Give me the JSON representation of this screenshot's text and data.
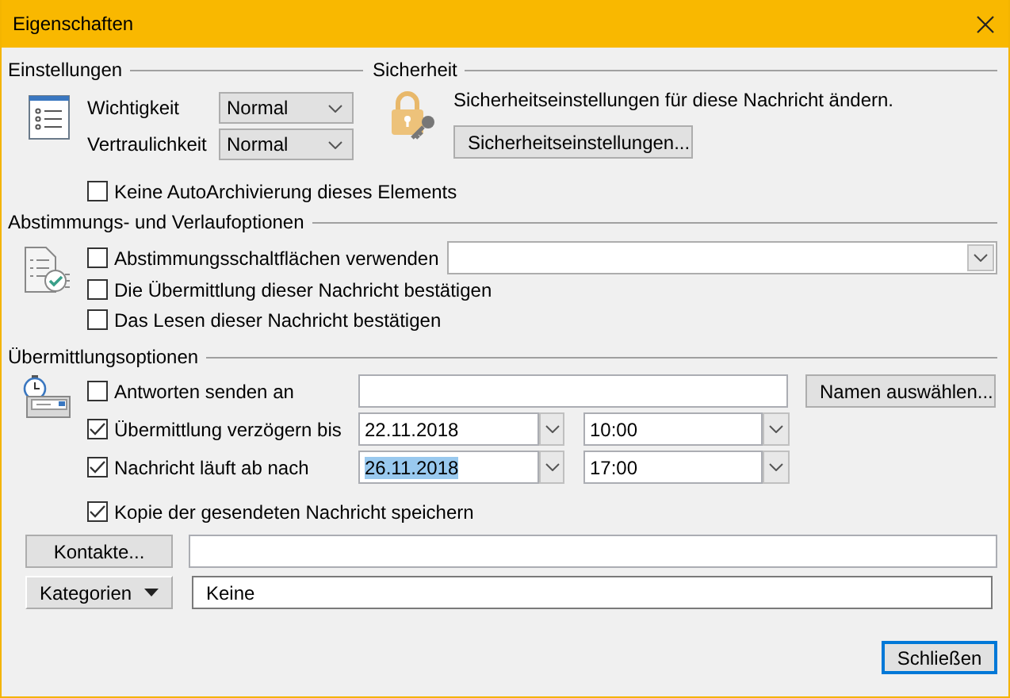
{
  "window": {
    "title": "Eigenschaften"
  },
  "settings": {
    "heading": "Einstellungen",
    "fields": [
      {
        "label": "Wichtigkeit",
        "value": "Normal"
      },
      {
        "label": "Vertraulichkeit",
        "value": "Normal"
      }
    ],
    "options": [
      {
        "label": "Keine AutoArchivierung dieses Elements",
        "checked": false
      }
    ]
  },
  "security": {
    "heading": "Sicherheit",
    "text": "Sicherheitseinstellungen für diese Nachricht ändern.",
    "button": "Sicherheitseinstellungen..."
  },
  "voting": {
    "heading": "Abstimmungs- und Verlaufoptionen",
    "options": [
      {
        "label": "Abstimmungsschaltflächen verwenden",
        "checked": false
      },
      {
        "label": "Die Übermittlung dieser Nachricht bestätigen",
        "checked": false
      },
      {
        "label": "Das Lesen dieser Nachricht bestätigen",
        "checked": false
      }
    ]
  },
  "delivery": {
    "heading": "Übermittlungsoptionen",
    "rows": [
      {
        "kind": "recipient",
        "label": "Antworten senden an",
        "checked": false,
        "button": "Namen auswählen..."
      },
      {
        "kind": "datetime",
        "label": "Übermittlung verzögern bis",
        "checked": true,
        "date": "22.11.2018",
        "time": "10:00",
        "selected": false
      },
      {
        "kind": "datetime",
        "label": "Nachricht läuft ab nach",
        "checked": true,
        "date": "26.11.2018",
        "time": "17:00",
        "selected": true
      }
    ],
    "save_copy": {
      "label": "Kopie der gesendeten Nachricht speichern",
      "checked": true
    }
  },
  "contacts": {
    "button": "Kontakte..."
  },
  "categories": {
    "button": "Kategorien",
    "value": "Keine"
  },
  "buttons": [
    {
      "label": "Schließen",
      "default": true
    }
  ]
}
